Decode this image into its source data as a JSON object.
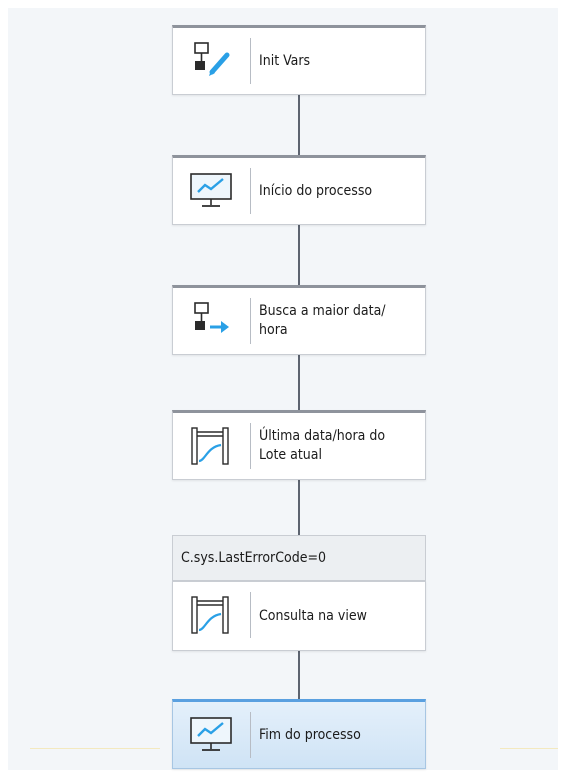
{
  "flow": {
    "nodes": [
      {
        "label": "Init Vars",
        "icon": "assign-variable-icon"
      },
      {
        "label": "Início do processo",
        "icon": "monitor-chart-icon"
      },
      {
        "label": "Busca a maior data/\nhora",
        "icon": "assign-arrow-icon"
      },
      {
        "label": "Última data/hora do\nLote atual",
        "icon": "database-query-icon"
      },
      {
        "label": "Consulta na view",
        "icon": "database-query-icon"
      },
      {
        "label": "Fim do processo",
        "icon": "monitor-chart-icon",
        "selected": true
      }
    ],
    "condition": {
      "label": "C.sys.LastErrorCode=0"
    }
  },
  "colors": {
    "connector": "#5d6470",
    "icon_blue": "#2aa0e6",
    "selected_top": "#5aa0e0"
  }
}
